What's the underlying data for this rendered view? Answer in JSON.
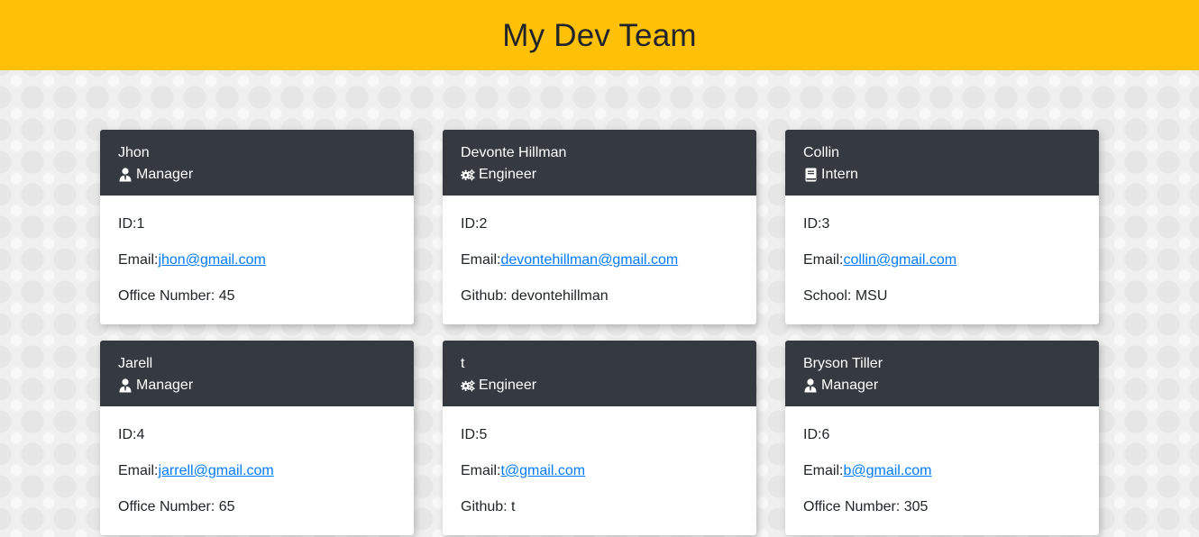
{
  "header": {
    "title": "My Dev Team"
  },
  "colors": {
    "header_bg": "#ffc107",
    "card_head_bg": "#343a40",
    "link": "#007bff"
  },
  "cards": [
    {
      "name": "Jhon",
      "role": "Manager",
      "icon": "manager-icon",
      "id_label": "ID:",
      "id": "1",
      "email_label": "Email:",
      "email": "jhon@gmail.com",
      "extra_label": "Office Number: ",
      "extra": "45"
    },
    {
      "name": "Devonte Hillman",
      "role": "Engineer",
      "icon": "gears-icon",
      "id_label": "ID:",
      "id": "2",
      "email_label": "Email:",
      "email": "devontehillman@gmail.com",
      "extra_label": "Github: ",
      "extra": "devontehillman"
    },
    {
      "name": "Collin",
      "role": "Intern",
      "icon": "book-icon",
      "id_label": "ID:",
      "id": "3",
      "email_label": "Email:",
      "email": "collin@gmail.com",
      "extra_label": "School: ",
      "extra": "MSU"
    },
    {
      "name": "Jarell",
      "role": "Manager",
      "icon": "manager-icon",
      "id_label": "ID:",
      "id": "4",
      "email_label": "Email:",
      "email": "jarrell@gmail.com",
      "extra_label": "Office Number: ",
      "extra": "65"
    },
    {
      "name": "t",
      "role": "Engineer",
      "icon": "gears-icon",
      "id_label": "ID:",
      "id": "5",
      "email_label": "Email:",
      "email": "t@gmail.com",
      "extra_label": "Github: ",
      "extra": "t"
    },
    {
      "name": "Bryson Tiller",
      "role": "Manager",
      "icon": "manager-icon",
      "id_label": "ID:",
      "id": "6",
      "email_label": "Email:",
      "email": "b@gmail.com",
      "extra_label": "Office Number: ",
      "extra": "305"
    }
  ]
}
